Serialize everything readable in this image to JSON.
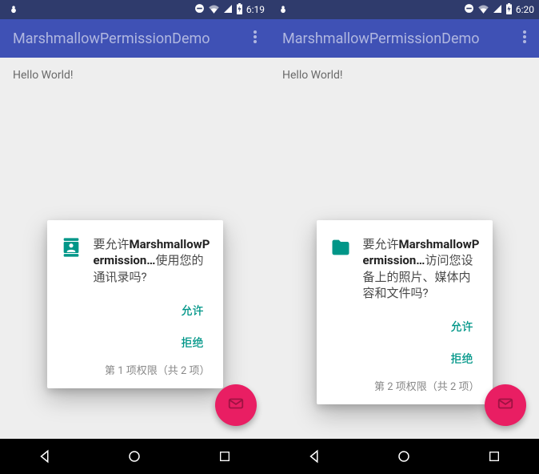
{
  "screens": [
    {
      "status": {
        "time": "6:19"
      },
      "actionbar": {
        "title": "MarshmallowPermissionDemo"
      },
      "content": {
        "hello": "Hello World!"
      },
      "dialog": {
        "icon": "contacts-icon",
        "prefix": "要允许",
        "app": "MarshmallowPermission…",
        "suffix": "使用您的通讯录吗?",
        "allow": "允许",
        "deny": "拒绝",
        "counter": "第 1 项权限（共 2 项）"
      }
    },
    {
      "status": {
        "time": "6:20"
      },
      "actionbar": {
        "title": "MarshmallowPermissionDemo"
      },
      "content": {
        "hello": "Hello World!"
      },
      "dialog": {
        "icon": "folder-icon",
        "prefix": "要允许",
        "app": "MarshmallowPermission…",
        "suffix": "访问您设备上的照片、媒体内容和文件吗?",
        "allow": "允许",
        "deny": "拒绝",
        "counter": "第 2 项权限（共 2 项）"
      }
    }
  ],
  "colors": {
    "primary": "#3f51b5",
    "primaryDark": "#2f3b6c",
    "accent": "#e91e63",
    "teal": "#009688"
  }
}
